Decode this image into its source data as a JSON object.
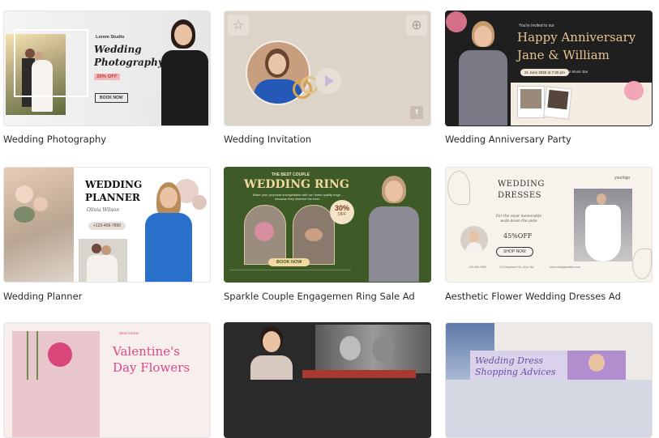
{
  "cards": [
    {
      "title": "Wedding Photography",
      "thumb": {
        "studio": "Lorem Studio",
        "line1": "Wedding",
        "line2": "Photography",
        "badge": "30% OFF",
        "button": "BOOK NOW"
      }
    },
    {
      "title": "Wedding Invitation",
      "thumb": {}
    },
    {
      "title": "Wedding Anniversary Party",
      "thumb": {
        "invite": "You're invited to our",
        "line1": "Happy Anniversary",
        "line2": "Jane & William",
        "date": "21 June 2030 at 7:30 pm",
        "venue": "At Music Bar"
      }
    },
    {
      "title": "Wedding Planner",
      "thumb": {
        "line1": "WEDDING",
        "line2": "PLANNER",
        "name": "Olivia Wilson",
        "phone": "+123-456-7890"
      }
    },
    {
      "title": "Sparkle Couple Engagemen Ring Sale Ad",
      "thumb": {
        "kicker": "THE BEST COUPLE",
        "line1": "WEDDING RING",
        "sub": "Make your proposal unforgettable with our finest quality rings - because they deserve the best.",
        "badge_top": "30%",
        "badge_bottom": "OFF",
        "button": "BOOK NOW"
      }
    },
    {
      "title": "Aesthetic Flower Wedding Dresses Ad",
      "thumb": {
        "logo": "yourlogo",
        "line1": "WEDDING",
        "line2": "DRESSES",
        "tagline": "For the most memorable walk down the aisle",
        "offer": "45%OFF",
        "button": "SHOP NOW",
        "phone": "123-456-7890",
        "address": "123 Anywhere St., Any City",
        "site": "www.reallygreatsite.com"
      }
    },
    {
      "title": "",
      "thumb": {
        "kicker": "Store Name",
        "line1": "Valentine's",
        "line2": "Day Flowers"
      }
    },
    {
      "title": "",
      "thumb": {}
    },
    {
      "title": "",
      "thumb": {
        "line1": "Wedding Dress",
        "line2": "Shopping Advices"
      }
    }
  ],
  "colors": {
    "green": "#3d5a27",
    "pink": "#e0468a",
    "anniv_gold": "#e7c58f"
  }
}
